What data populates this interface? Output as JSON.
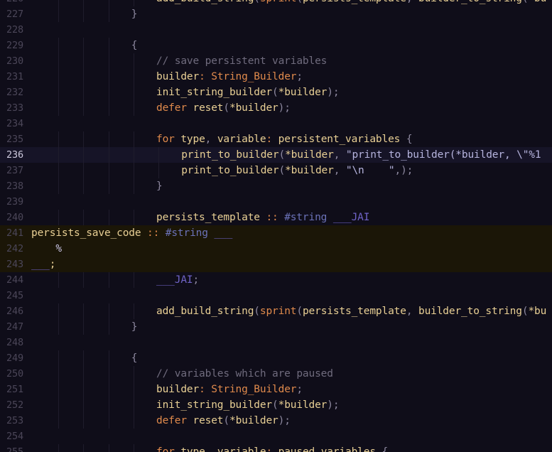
{
  "editor": {
    "current_line": 236,
    "lines": [
      {
        "n": "226",
        "indent": 5,
        "tokens": [
          {
            "c": "id",
            "t": "add_build_string"
          },
          {
            "c": "pn",
            "t": "("
          },
          {
            "c": "kw",
            "t": "sprint"
          },
          {
            "c": "pn",
            "t": "("
          },
          {
            "c": "id",
            "t": "persists_template"
          },
          {
            "c": "pn",
            "t": ", "
          },
          {
            "c": "id",
            "t": "builder_to_string"
          },
          {
            "c": "pn",
            "t": "("
          },
          {
            "c": "id",
            "t": "*bu"
          }
        ]
      },
      {
        "n": "227",
        "indent": 4,
        "tokens": [
          {
            "c": "pn",
            "t": "}"
          }
        ]
      },
      {
        "n": "228",
        "indent": 0,
        "tokens": []
      },
      {
        "n": "229",
        "indent": 4,
        "tokens": [
          {
            "c": "pn",
            "t": "{"
          }
        ]
      },
      {
        "n": "230",
        "indent": 5,
        "tokens": [
          {
            "c": "cm",
            "t": "// save persistent variables"
          }
        ]
      },
      {
        "n": "231",
        "indent": 5,
        "tokens": [
          {
            "c": "id",
            "t": "builder"
          },
          {
            "c": "op",
            "t": ": "
          },
          {
            "c": "ty",
            "t": "String_Builder"
          },
          {
            "c": "pn",
            "t": ";"
          }
        ]
      },
      {
        "n": "232",
        "indent": 5,
        "tokens": [
          {
            "c": "id",
            "t": "init_string_builder"
          },
          {
            "c": "pn",
            "t": "("
          },
          {
            "c": "id",
            "t": "*builder"
          },
          {
            "c": "pn",
            "t": ");"
          }
        ]
      },
      {
        "n": "233",
        "indent": 5,
        "tokens": [
          {
            "c": "kw",
            "t": "defer "
          },
          {
            "c": "id",
            "t": "reset"
          },
          {
            "c": "pn",
            "t": "("
          },
          {
            "c": "id",
            "t": "*builder"
          },
          {
            "c": "pn",
            "t": ");"
          }
        ]
      },
      {
        "n": "234",
        "indent": 0,
        "tokens": []
      },
      {
        "n": "235",
        "indent": 5,
        "tokens": [
          {
            "c": "kw",
            "t": "for "
          },
          {
            "c": "id",
            "t": "type"
          },
          {
            "c": "pn",
            "t": ", "
          },
          {
            "c": "id",
            "t": "variable"
          },
          {
            "c": "op",
            "t": ": "
          },
          {
            "c": "id",
            "t": "persistent_variables"
          },
          {
            "c": "pn",
            "t": " {"
          }
        ]
      },
      {
        "n": "236",
        "indent": 6,
        "current": true,
        "tokens": [
          {
            "c": "id",
            "t": "print_to_builder"
          },
          {
            "c": "pn",
            "t": "("
          },
          {
            "c": "id",
            "t": "*builder"
          },
          {
            "c": "pn",
            "t": ", "
          },
          {
            "c": "str",
            "t": "\"print_to_builder(*builder, \\\"%1"
          }
        ]
      },
      {
        "n": "237",
        "indent": 6,
        "tokens": [
          {
            "c": "id",
            "t": "print_to_builder"
          },
          {
            "c": "pn",
            "t": "("
          },
          {
            "c": "id",
            "t": "*builder"
          },
          {
            "c": "pn",
            "t": ", "
          },
          {
            "c": "str",
            "t": "\"\\n    \""
          },
          {
            "c": "pn",
            "t": ",);"
          }
        ]
      },
      {
        "n": "238",
        "indent": 5,
        "tokens": [
          {
            "c": "pn",
            "t": "}"
          }
        ]
      },
      {
        "n": "239",
        "indent": 0,
        "tokens": []
      },
      {
        "n": "240",
        "indent": 5,
        "tokens": [
          {
            "c": "id",
            "t": "persists_template "
          },
          {
            "c": "op",
            "t": ":: "
          },
          {
            "c": "dir",
            "t": "#string "
          },
          {
            "c": "tag",
            "t": "___JAI"
          }
        ]
      },
      {
        "n": "241",
        "indent": 0,
        "hl": true,
        "tokens": [
          {
            "c": "tx",
            "t": "persists_save_code "
          },
          {
            "c": "op",
            "t": ":: "
          },
          {
            "c": "dir",
            "t": "#string "
          },
          {
            "c": "tag",
            "t": "___"
          }
        ]
      },
      {
        "n": "242",
        "indent": 0,
        "hl": true,
        "tokens": [
          {
            "c": "tx-c",
            "t": "    %"
          }
        ]
      },
      {
        "n": "243",
        "indent": 0,
        "hl": true,
        "tokens": [
          {
            "c": "tag",
            "t": "___"
          },
          {
            "c": "tx",
            "t": ";"
          }
        ]
      },
      {
        "n": "244",
        "indent": 5,
        "tokens": [
          {
            "c": "tag",
            "t": "___JAI"
          },
          {
            "c": "pn",
            "t": ";"
          }
        ]
      },
      {
        "n": "245",
        "indent": 0,
        "tokens": []
      },
      {
        "n": "246",
        "indent": 5,
        "tokens": [
          {
            "c": "id",
            "t": "add_build_string"
          },
          {
            "c": "pn",
            "t": "("
          },
          {
            "c": "kw",
            "t": "sprint"
          },
          {
            "c": "pn",
            "t": "("
          },
          {
            "c": "id",
            "t": "persists_template"
          },
          {
            "c": "pn",
            "t": ", "
          },
          {
            "c": "id",
            "t": "builder_to_string"
          },
          {
            "c": "pn",
            "t": "("
          },
          {
            "c": "id",
            "t": "*bu"
          }
        ]
      },
      {
        "n": "247",
        "indent": 4,
        "tokens": [
          {
            "c": "pn",
            "t": "}"
          }
        ]
      },
      {
        "n": "248",
        "indent": 0,
        "tokens": []
      },
      {
        "n": "249",
        "indent": 4,
        "tokens": [
          {
            "c": "pn",
            "t": "{"
          }
        ]
      },
      {
        "n": "250",
        "indent": 5,
        "tokens": [
          {
            "c": "cm",
            "t": "// variables which are paused"
          }
        ]
      },
      {
        "n": "251",
        "indent": 5,
        "tokens": [
          {
            "c": "id",
            "t": "builder"
          },
          {
            "c": "op",
            "t": ": "
          },
          {
            "c": "ty",
            "t": "String_Builder"
          },
          {
            "c": "pn",
            "t": ";"
          }
        ]
      },
      {
        "n": "252",
        "indent": 5,
        "tokens": [
          {
            "c": "id",
            "t": "init_string_builder"
          },
          {
            "c": "pn",
            "t": "("
          },
          {
            "c": "id",
            "t": "*builder"
          },
          {
            "c": "pn",
            "t": ");"
          }
        ]
      },
      {
        "n": "253",
        "indent": 5,
        "tokens": [
          {
            "c": "kw",
            "t": "defer "
          },
          {
            "c": "id",
            "t": "reset"
          },
          {
            "c": "pn",
            "t": "("
          },
          {
            "c": "id",
            "t": "*builder"
          },
          {
            "c": "pn",
            "t": ");"
          }
        ]
      },
      {
        "n": "254",
        "indent": 0,
        "tokens": []
      },
      {
        "n": "255",
        "indent": 5,
        "tokens": [
          {
            "c": "kw",
            "t": "for "
          },
          {
            "c": "id",
            "t": "type"
          },
          {
            "c": "pn",
            "t": ", "
          },
          {
            "c": "id",
            "t": "variable"
          },
          {
            "c": "op",
            "t": ": "
          },
          {
            "c": "id",
            "t": "paused_variables"
          },
          {
            "c": "pn",
            "t": " {"
          }
        ]
      }
    ]
  },
  "theme": {
    "background": "#0f0d19",
    "current_line_background": "#161427",
    "highlight_background": "#1b1607",
    "keyword_color": "#e08a4c",
    "identifier_color": "#e8cf94",
    "comment_color": "#6f6b7d"
  }
}
